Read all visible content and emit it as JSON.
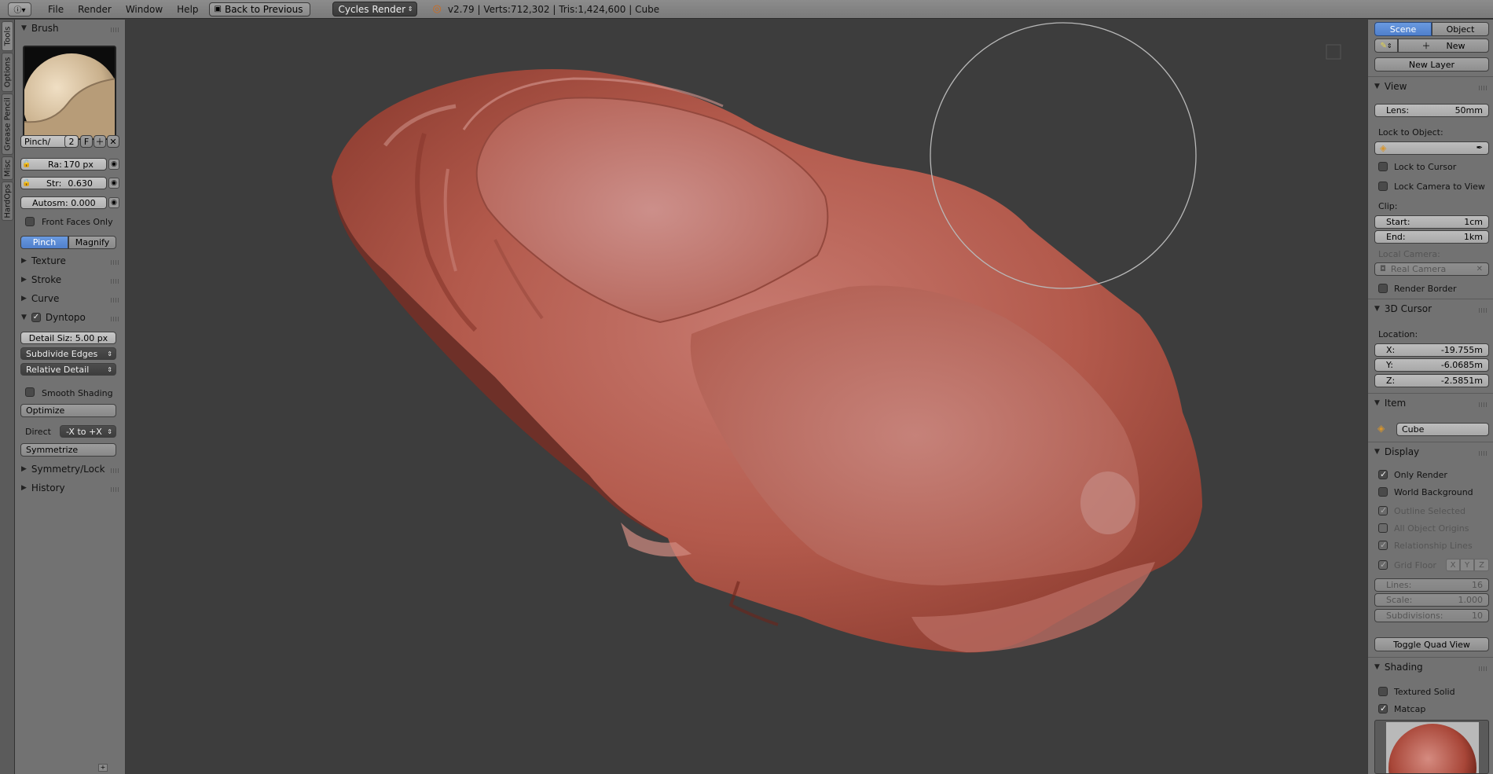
{
  "topbar": {
    "menus": [
      "File",
      "Render",
      "Window",
      "Help"
    ],
    "back_label": "Back to Previous",
    "render_engine": "Cycles Render",
    "stats": "v2.79 | Verts:712,302 | Tris:1,424,600 | Cube"
  },
  "tabs": [
    "Tools",
    "Options",
    "Grease Pencil",
    "Misc",
    "HardOps"
  ],
  "left": {
    "brush_header": "Brush",
    "brush_name": "Pinch/",
    "brush_users": "2",
    "brush_fake": "F",
    "radius_label": "Ra:",
    "radius_value": "170 px",
    "strength_label": "Str:",
    "strength_value": "0.630",
    "autosmooth": "Autosm: 0.000",
    "front_faces": "Front Faces Only",
    "mode_pinch": "Pinch",
    "mode_magnify": "Magnify",
    "texture": "Texture",
    "stroke": "Stroke",
    "curve": "Curve",
    "dyntopo": "Dyntopo",
    "detail_size": "Detail Siz: 5.00 px",
    "subdivide": "Subdivide Edges",
    "relative": "Relative Detail",
    "smooth_shading": "Smooth Shading",
    "optimize": "Optimize",
    "direction_label": "Direct",
    "direction_value": "-X to +X",
    "symmetrize": "Symmetrize",
    "symmetry": "Symmetry/Lock",
    "history": "History"
  },
  "right": {
    "tab_scene": "Scene",
    "tab_object": "Object",
    "new_label": "New",
    "new_layer": "New Layer",
    "view_header": "View",
    "lens_label": "Lens:",
    "lens_value": "50mm",
    "lock_to_object": "Lock to Object:",
    "lock_to_cursor": "Lock to Cursor",
    "lock_camera": "Lock Camera to View",
    "clip_label": "Clip:",
    "clip_start_label": "Start:",
    "clip_start_value": "1cm",
    "clip_end_label": "End:",
    "clip_end_value": "1km",
    "local_camera": "Local Camera:",
    "real_camera": "Real Camera",
    "render_border": "Render Border",
    "cursor_header": "3D Cursor",
    "location_label": "Location:",
    "x_label": "X:",
    "x_value": "-19.755m",
    "y_label": "Y:",
    "y_value": "-6.0685m",
    "z_label": "Z:",
    "z_value": "-2.5851m",
    "item_header": "Item",
    "item_name": "Cube",
    "display_header": "Display",
    "only_render": "Only Render",
    "world_background": "World Background",
    "outline_selected": "Outline Selected",
    "all_origins": "All Object Origins",
    "relationship_lines": "Relationship Lines",
    "grid_floor": "Grid Floor",
    "axis_x": "X",
    "axis_y": "Y",
    "axis_z": "Z",
    "lines_label": "Lines:",
    "lines_value": "16",
    "scale_label": "Scale:",
    "scale_value": "1.000",
    "subdiv_label": "Subdivisions:",
    "subdiv_value": "10",
    "toggle_quad": "Toggle Quad View",
    "shading_header": "Shading",
    "textured_solid": "Textured Solid",
    "matcap": "Matcap"
  },
  "colors": {
    "accent_blue": "#5a8ad8",
    "sculpt_red": "#b05445",
    "viewport_bg": "#3d3d3d"
  }
}
